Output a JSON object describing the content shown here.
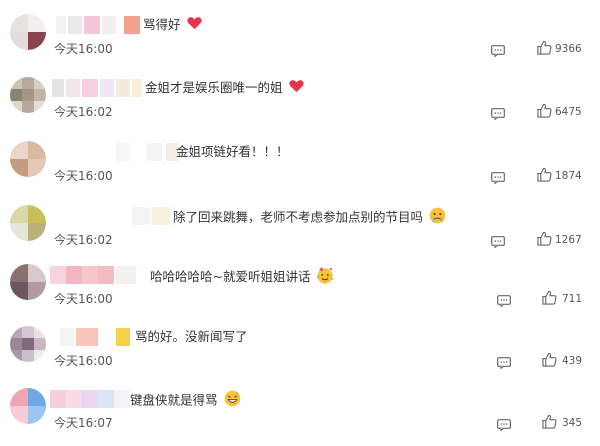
{
  "comments": [
    {
      "text": "骂得好",
      "emoji": "heart-emoji",
      "time": "今天16:00",
      "likes": "9366"
    },
    {
      "text": "金姐才是娱乐圈唯一的姐",
      "emoji": "heart-emoji",
      "time": "今天16:02",
      "likes": "6475"
    },
    {
      "text": "金姐项链好看！！！",
      "emoji": "",
      "time": "今天16:00",
      "likes": "1874"
    },
    {
      "text": "除了回来跳舞，老师不考虑参加点别的节目吗",
      "emoji": "crying-face-emoji",
      "time": "今天16:02",
      "likes": "1267"
    },
    {
      "text": "哈哈哈哈哈~就爱听姐姐讲话",
      "emoji": "party-face-emoji",
      "time": "今天16:00",
      "likes": "711"
    },
    {
      "text": "骂的好。没新闻写了",
      "emoji": "",
      "time": "今天16:00",
      "likes": "439"
    },
    {
      "text": "键盘侠就是得骂",
      "emoji": "grinning-sweat-emoji",
      "time": "今天16:07",
      "likes": "345"
    }
  ],
  "icons": {
    "reply": "comment-icon",
    "like": "thumbs-up-icon"
  },
  "colors": {
    "text": "#333333",
    "meta": "#555555",
    "heart": "#e8344a",
    "emoji_face": "#f6c33b"
  }
}
